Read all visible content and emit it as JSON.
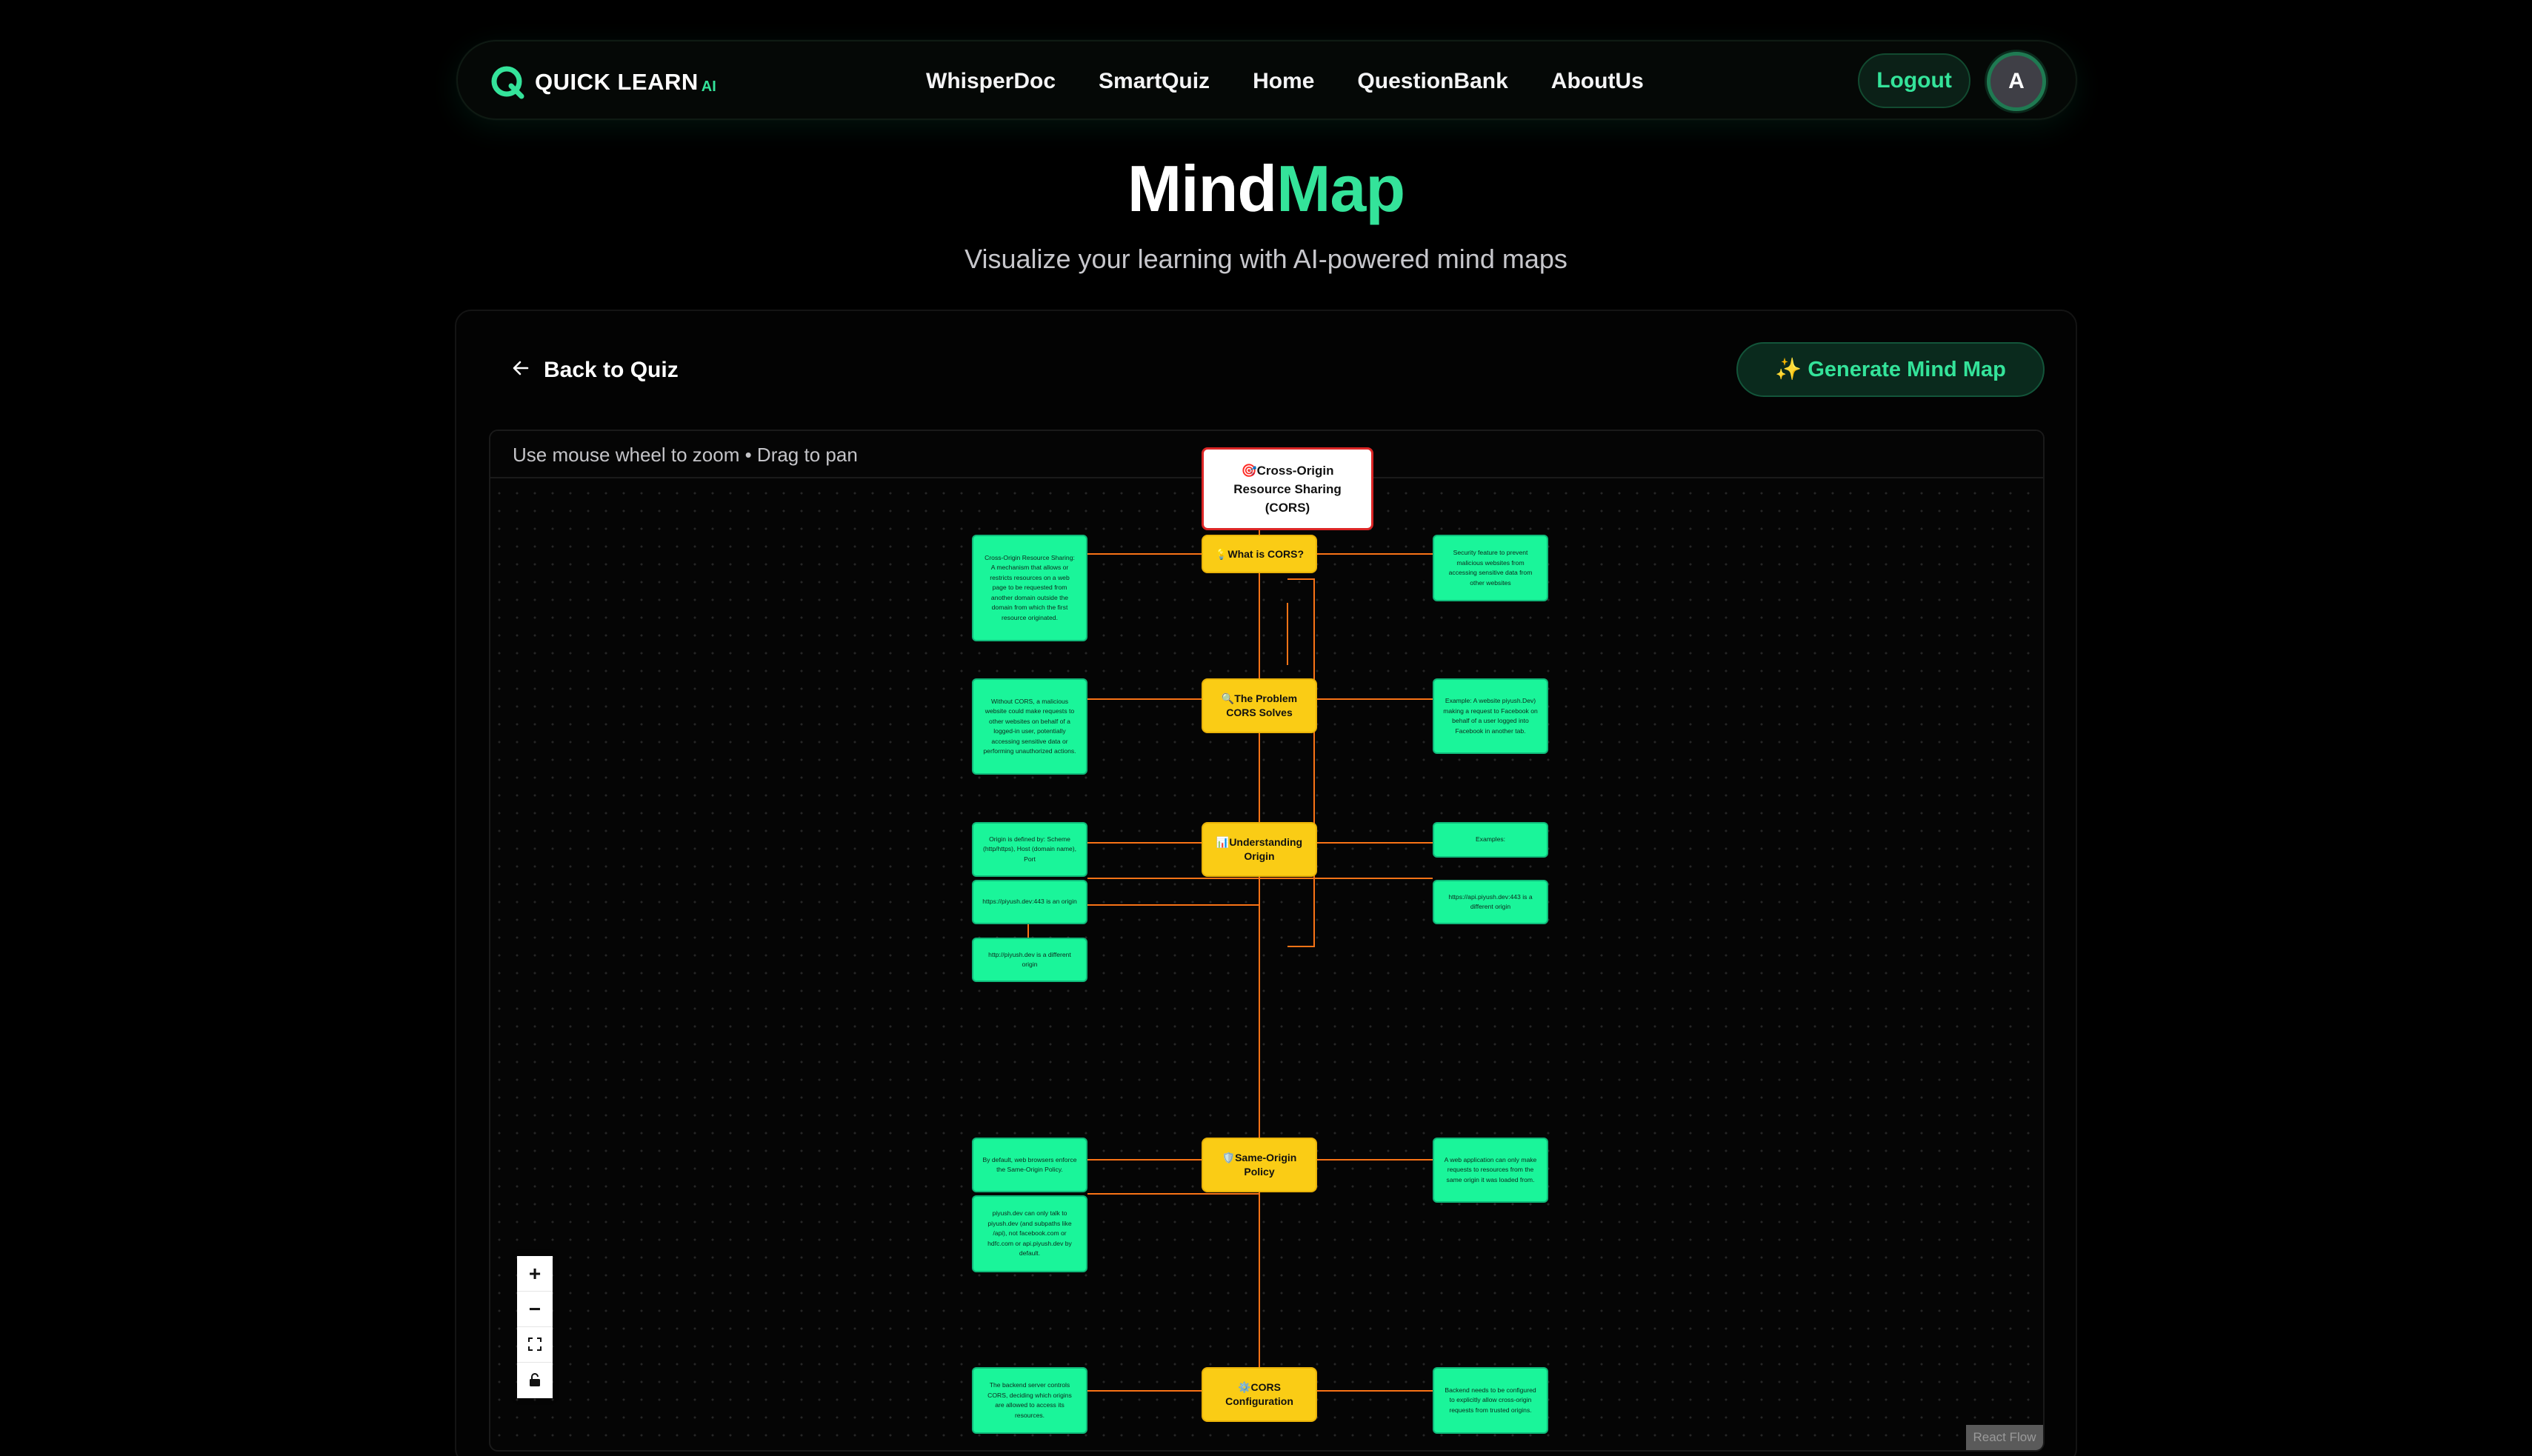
{
  "nav": {
    "logo_text": "QUICK LEARN",
    "logo_sub": "AI",
    "links": [
      "WhisperDoc",
      "SmartQuiz",
      "Home",
      "QuestionBank",
      "AboutUs"
    ],
    "logout_label": "Logout",
    "avatar_initial": "A"
  },
  "header": {
    "title_part1": "Mind",
    "title_part2": "Map",
    "subtitle": "Visualize your learning with AI-powered mind maps"
  },
  "toolbar": {
    "back_label": "Back to Quiz",
    "generate_label": "✨ Generate Mind Map"
  },
  "flow": {
    "hint": "Use mouse wheel to zoom • Drag to pan",
    "attribution": "React Flow",
    "controls": {
      "zoom_in": "+",
      "zoom_out": "−",
      "fit": "⛶",
      "lock": "🔒"
    }
  },
  "mindmap": {
    "root": "🎯Cross-Origin Resource Sharing (CORS)",
    "topics": [
      {
        "label": "💡What is CORS?"
      },
      {
        "label": "🔍The Problem CORS Solves"
      },
      {
        "label": "📊Understanding Origin"
      },
      {
        "label": "🛡️Same-Origin Policy"
      },
      {
        "label": "⚙️CORS Configuration"
      }
    ],
    "details": [
      "Cross-Origin Resource Sharing: A mechanism that allows or restricts resources on a web page to be requested from another domain outside the domain from which the first resource originated.",
      "Security feature to prevent malicious websites from accessing sensitive data from other websites",
      "Without CORS, a malicious website could make requests to other websites on behalf of a logged-in user, potentially accessing sensitive data or performing unauthorized actions.",
      "Example: A website piyush.Dev) making a request to Facebook on behalf of a user logged into Facebook in another tab.",
      "Origin is defined by: Scheme (http/https), Host (domain name), Port",
      "Examples:",
      "https://piyush.dev:443 is an origin",
      "https://api.piyush.dev:443 is a different origin",
      "http://piyush.dev is a different origin",
      "By default, web browsers enforce the Same-Origin Policy.",
      "A web application can only make requests to resources from the same origin it was loaded from.",
      "piyush.dev can only talk to piyush.dev (and subpaths like /api), not facebook.com or hdfc.com or api.piyush.dev by default.",
      "The backend server controls CORS, deciding which origins are allowed to access its resources.",
      "Backend needs to be configured to explicitly allow cross-origin requests from trusted origins."
    ]
  },
  "colors": {
    "accent": "#34e39a",
    "topic_node": "#facc15",
    "detail_node": "#1af59a",
    "root_border": "#dc2626",
    "edge": "#f97316"
  }
}
